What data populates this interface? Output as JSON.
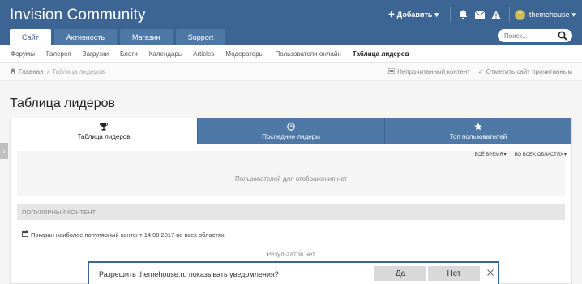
{
  "header": {
    "brand": "Invision Community",
    "add_label": "Добавить",
    "user_name": "themehouse",
    "avatar_letter": "T",
    "nav_tabs": [
      {
        "label": "Сайт"
      },
      {
        "label": "Активность"
      },
      {
        "label": "Магазин"
      },
      {
        "label": "Support"
      }
    ],
    "search_placeholder": "Поиск..."
  },
  "subnav": {
    "items": [
      {
        "label": "Форумы"
      },
      {
        "label": "Галерея"
      },
      {
        "label": "Загрузки"
      },
      {
        "label": "Блоги"
      },
      {
        "label": "Календарь"
      },
      {
        "label": "Articles"
      },
      {
        "label": "Модераторы"
      },
      {
        "label": "Пользователи онлайн"
      },
      {
        "label": "Таблица лидеров"
      }
    ]
  },
  "breadcrumb": {
    "home": "Главная",
    "current": "Таблица лидеров",
    "unread": "Непрочитанный контент",
    "mark_read": "Отметить сайт прочитанным"
  },
  "page": {
    "title": "Таблица лидеров"
  },
  "leaderboard": {
    "tabs": [
      {
        "label": "Таблица лидеров",
        "icon": "trophy-icon"
      },
      {
        "label": "Последние лидеры",
        "icon": "clock-icon"
      },
      {
        "label": "Топ пользователей",
        "icon": "star-icon"
      }
    ],
    "filter_time": "Всё время",
    "filter_area": "Во всех областях",
    "no_users": "Пользователей для отображения нет",
    "popular_heading": "Популярный контент",
    "popular_info": "Показан наиболее популярный контент 14.08.2017 во всех областях",
    "no_results": "Результатов нет"
  },
  "notification": {
    "text": "Разрешить themehouse.ru показывать уведомления?",
    "yes": "Да",
    "no": "Нет"
  },
  "colors": {
    "header": "#3d6594",
    "tab": "#4e78a6",
    "page_bg": "#f5f5f5"
  }
}
